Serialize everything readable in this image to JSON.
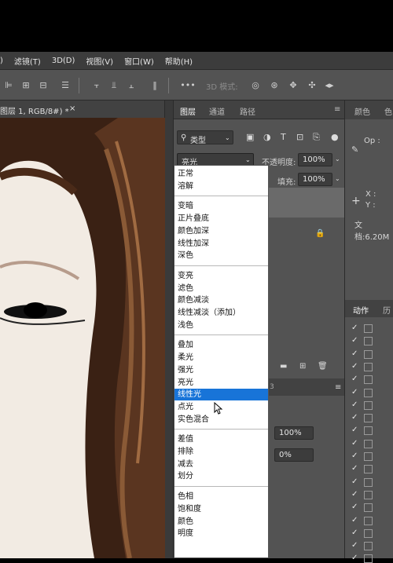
{
  "menu": [
    ") ",
    "滤镜(T)",
    "3D(D)",
    "视图(V)",
    "窗口(W)",
    "帮助(H)"
  ],
  "options": {
    "mode_label": "3D 模式:",
    "more": "•••"
  },
  "document": {
    "tab_title": "图层 1, RGB/8#) *",
    "close": "×"
  },
  "layers_panel": {
    "tabs": [
      "图层",
      "通道",
      "路径"
    ],
    "filter_label": "类型",
    "blend_mode": "亮光",
    "opacity_label": "不透明度:",
    "opacity_value": "100%",
    "fill_label": "填充:",
    "fill_value": "100%",
    "props_value1": "100%",
    "props_value2": "0%"
  },
  "blend_groups": [
    [
      "正常",
      "溶解"
    ],
    [
      "变暗",
      "正片叠底",
      "颜色加深",
      "线性加深",
      "深色"
    ],
    [
      "变亮",
      "滤色",
      "颜色减淡",
      "线性减淡（添加）",
      "浅色"
    ],
    [
      "叠加",
      "柔光",
      "强光",
      "亮光",
      "线性光",
      "点光",
      "实色混合"
    ],
    [
      "差值",
      "排除",
      "减去",
      "划分"
    ],
    [
      "色相",
      "饱和度",
      "颜色",
      "明度"
    ]
  ],
  "highlighted": "线性光",
  "right_panel": {
    "tabs": [
      "颜色",
      "色"
    ],
    "op_label": "Op :",
    "x_label": "X :",
    "y_label": "Y :",
    "doc_label": "文档:6.20M",
    "actions_tab": "动作",
    "history_tab": "历"
  }
}
